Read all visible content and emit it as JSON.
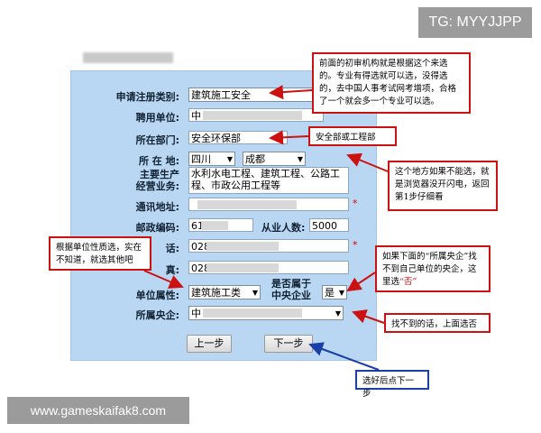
{
  "watermark_top": "TG: MYYJJPP",
  "watermark_bottom": "www.gameskaifak8.com",
  "form": {
    "register_type": {
      "label": "申请注册类别:",
      "value": "建筑施工安全"
    },
    "employer": {
      "label": "聘用单位:",
      "value": "中"
    },
    "department": {
      "label": "所在部门:",
      "value": "安全环保部"
    },
    "location": {
      "label": "所 在 地:",
      "province": "四川",
      "city": "成都"
    },
    "business": {
      "label_line1": "主要生产",
      "label_line2": "经营业务:",
      "value": "水利水电工程、建筑工程、公路工程、市政公用工程等"
    },
    "address": {
      "label": "通讯地址:"
    },
    "postcode": {
      "label": "邮政编码:",
      "value": "61",
      "employees_label": "从业人数:",
      "employees_value": "5000"
    },
    "phone": {
      "label": "话:",
      "value": "028"
    },
    "fax": {
      "label": "真:",
      "value": "028"
    },
    "unit_property": {
      "label": "单位属性:",
      "value": "建筑施工类"
    },
    "central_enterprise": {
      "label_line1": "是否属于",
      "label_line2": "中央企业",
      "value": "是"
    },
    "affiliated": {
      "label": "所属央企:",
      "value": "中"
    },
    "required_mark": "*",
    "prev_button": "上一步",
    "next_button": "下一步"
  },
  "callouts": {
    "c1": "前面的初审机构就是根据这个来选的。专业有得选就可以选，没得选的，去中国人事考试网考增项，合格了一个就会多一个专业可以选。",
    "c2": "安全部或工程部",
    "c3": "这个地方如果不能选，就是浏览器没开闪电，返回第1步仔细看",
    "c4": "根据单位性质选，实在不知道，就选其他吧",
    "c5_line1": "如果下面的“所属央企”找不到自己单位的央企，这里选",
    "c5_red": "“否”",
    "c6": "找不到的话，上面选否",
    "c7": "选好后点下一步"
  },
  "colors": {
    "callout_red": "#cc1111",
    "callout_blue": "#1a3fa8",
    "form_bg": "#b9d7f2"
  }
}
